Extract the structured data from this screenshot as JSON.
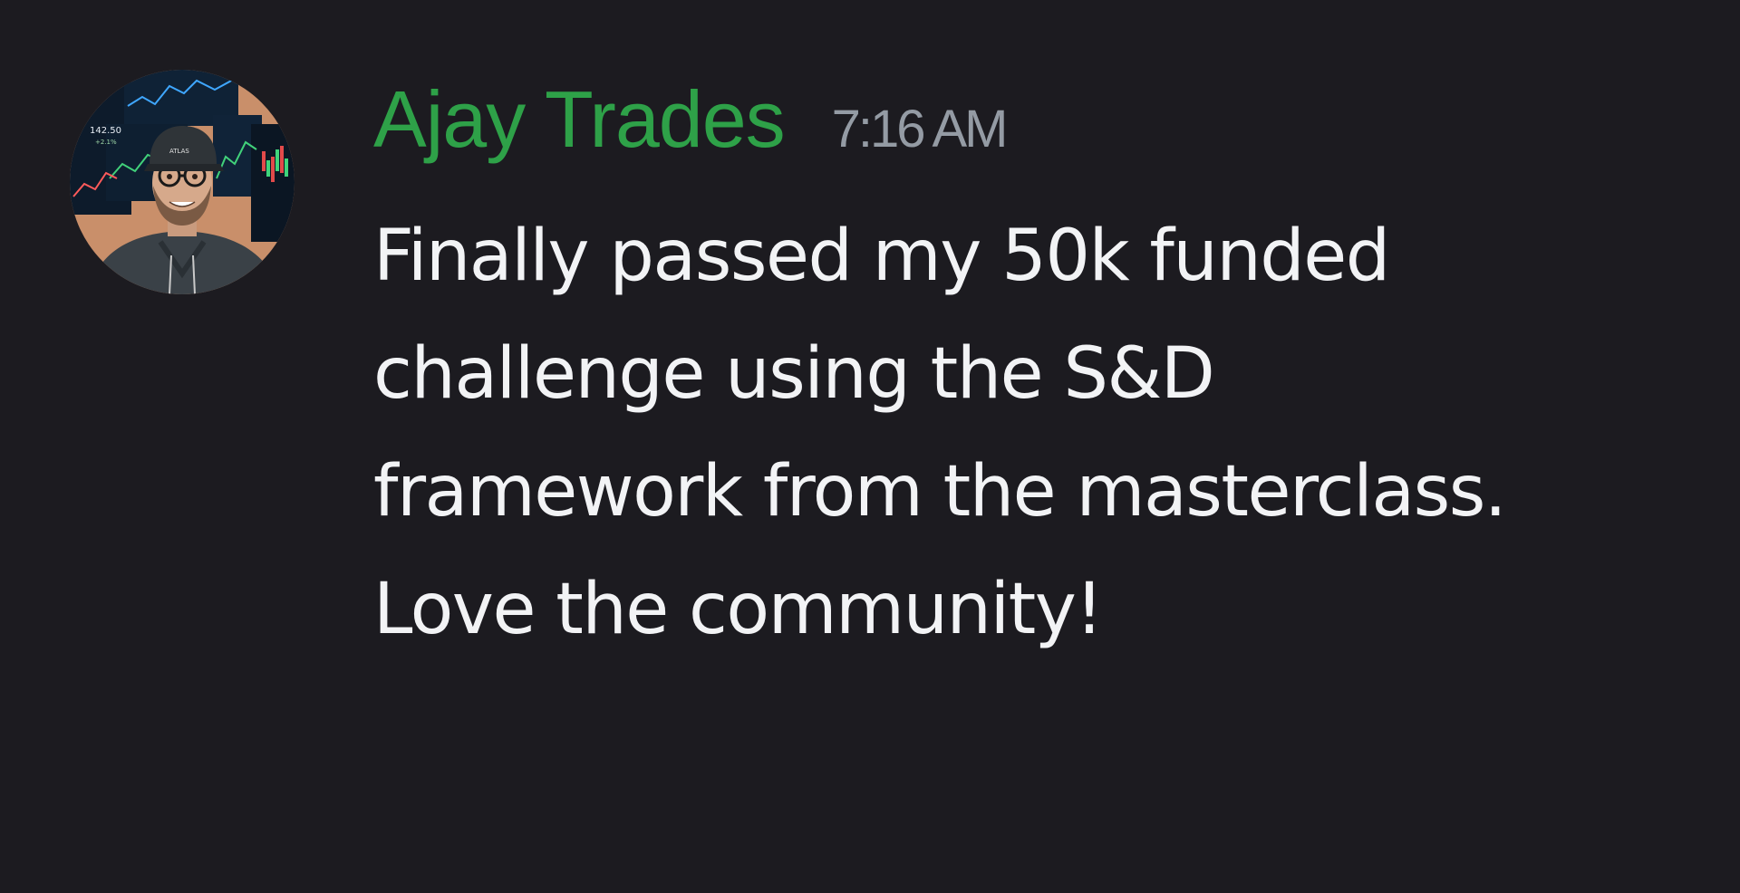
{
  "message": {
    "author": "Ajay Trades",
    "timestamp": "7:16 AM",
    "content": "Finally passed my 50k funded challenge using the S&D framework from the masterclass. Love the community!",
    "author_color": "#2ea148",
    "text_color": "#f2f3f5",
    "timestamp_color": "#949ba4",
    "background_color": "#1c1b20"
  },
  "avatar": {
    "icon": "user-avatar-icon",
    "chart_screen_text": "142.50",
    "chart_screen_subtext": "+2.1%",
    "cap_text": "ATLAS"
  }
}
